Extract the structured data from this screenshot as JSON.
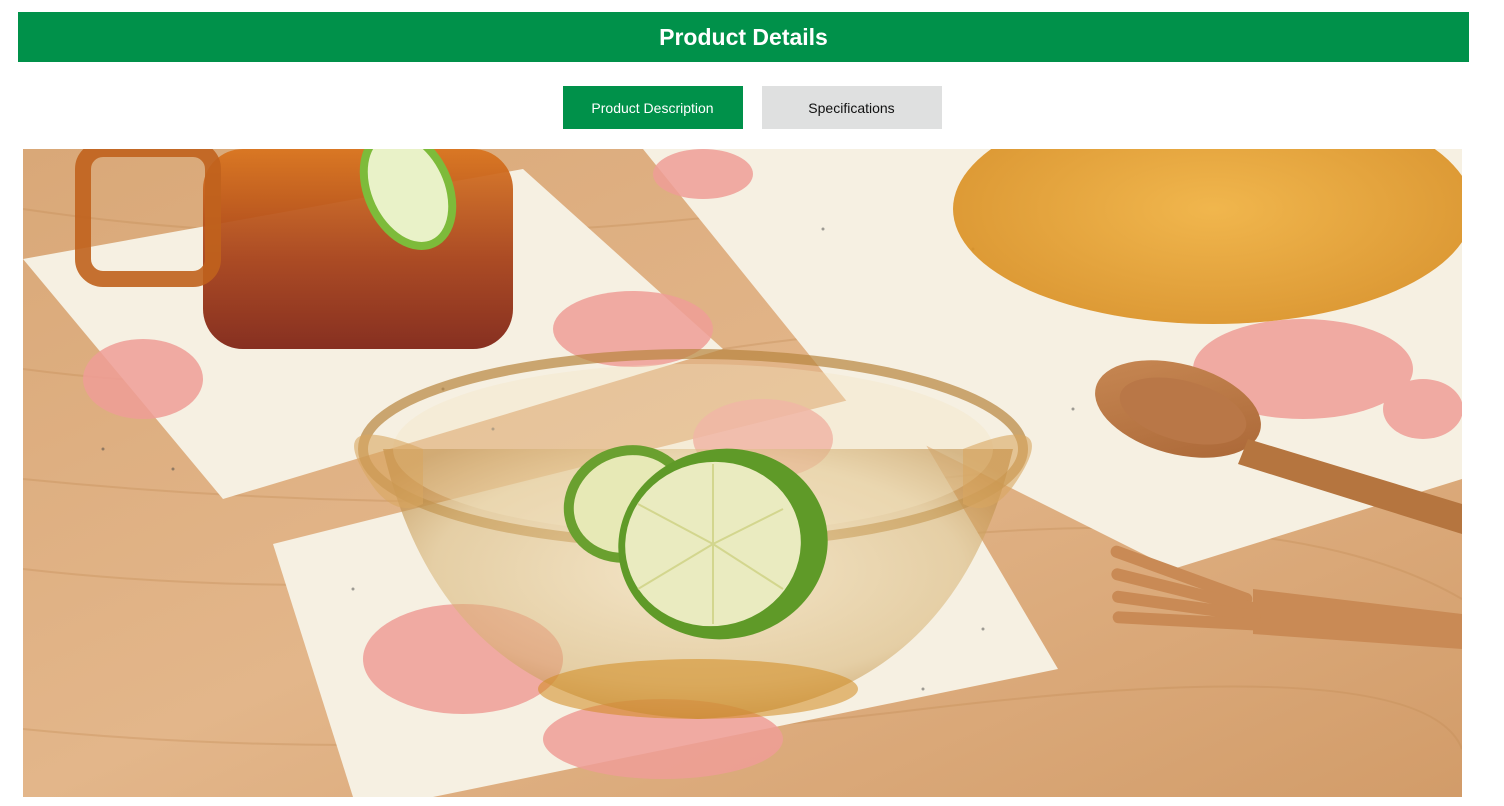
{
  "header": {
    "title": "Product Details"
  },
  "tabs": [
    {
      "label": "Product Description",
      "active": true
    },
    {
      "label": "Specifications",
      "active": false
    }
  ],
  "image": {
    "subject": "amber glass bowl with lime slices on coasters with wooden spoon and fork"
  },
  "colors": {
    "brand_green": "#00914a",
    "tab_inactive": "#dfe0e0"
  }
}
